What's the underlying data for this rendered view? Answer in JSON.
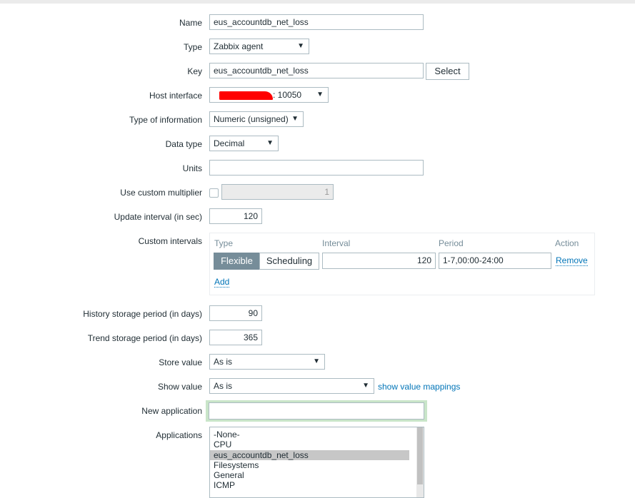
{
  "form": {
    "name": {
      "label": "Name",
      "value": "eus_accountdb_net_loss"
    },
    "type": {
      "label": "Type",
      "value": "Zabbix agent"
    },
    "key": {
      "label": "Key",
      "value": "eus_accountdb_net_loss",
      "select_label": "Select"
    },
    "host_interface": {
      "label": "Host interface",
      "value": ": 10050"
    },
    "type_of_information": {
      "label": "Type of information",
      "value": "Numeric (unsigned)"
    },
    "data_type": {
      "label": "Data type",
      "value": "Decimal"
    },
    "units": {
      "label": "Units",
      "value": ""
    },
    "custom_multiplier": {
      "label": "Use custom multiplier",
      "checked": false,
      "value": "1"
    },
    "update_interval": {
      "label": "Update interval (in sec)",
      "value": "120"
    },
    "custom_intervals": {
      "label": "Custom intervals",
      "headers": {
        "type": "Type",
        "interval": "Interval",
        "period": "Period",
        "action": "Action"
      },
      "rows": [
        {
          "flexible": "Flexible",
          "scheduling": "Scheduling",
          "active": "Flexible",
          "interval": "120",
          "period": "1-7,00:00-24:00",
          "remove": "Remove"
        }
      ],
      "add": "Add"
    },
    "history": {
      "label": "History storage period (in days)",
      "value": "90"
    },
    "trend": {
      "label": "Trend storage period (in days)",
      "value": "365"
    },
    "store_value": {
      "label": "Store value",
      "value": "As is"
    },
    "show_value": {
      "label": "Show value",
      "value": "As is",
      "link": "show value mappings"
    },
    "new_application": {
      "label": "New application",
      "value": ""
    },
    "applications": {
      "label": "Applications",
      "items": [
        "-None-",
        "CPU",
        "eus_accountdb_net_loss",
        "Filesystems",
        "General",
        "ICMP"
      ],
      "selected": "eus_accountdb_net_loss"
    }
  },
  "colors": {
    "accent": "#0275b8",
    "active_toggle": "#768d99",
    "focus_border": "#c9e5c9",
    "redaction": "#ff0000"
  },
  "icons": {
    "dropdown": "triangle-down-icon"
  }
}
